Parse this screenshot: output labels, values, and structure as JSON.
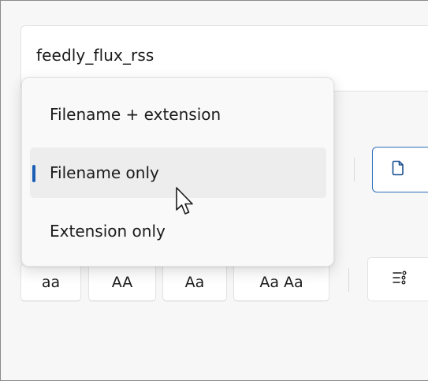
{
  "search": {
    "value": "feedly_flux_rss"
  },
  "rename_part_menu": {
    "options": [
      {
        "label": "Filename + extension",
        "selected": false
      },
      {
        "label": "Filename only",
        "selected": true
      },
      {
        "label": "Extension only",
        "selected": false
      }
    ]
  },
  "case_buttons": [
    {
      "label": "aa"
    },
    {
      "label": "AA"
    },
    {
      "label": "Aa"
    },
    {
      "label": "Aa Aa"
    }
  ],
  "icons": {
    "file_button": "file-icon",
    "settings_button": "list-settings-icon",
    "cursor": "mouse-pointer-icon"
  },
  "colors": {
    "accent": "#1a5fb4",
    "selected_bg": "#ededed",
    "menu_bg": "#f9f9f9",
    "window_bg": "#f7f7f7"
  }
}
